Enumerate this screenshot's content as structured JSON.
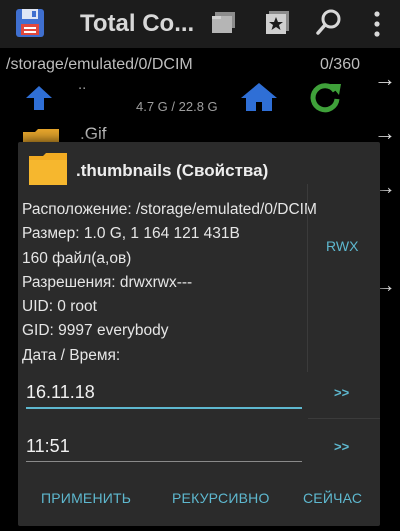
{
  "appbar": {
    "title": "Total Co...",
    "icons": [
      "floppy-save-icon",
      "folders-icon",
      "bookmark-star-icon",
      "search-icon",
      "overflow-menu-icon"
    ],
    "accent": "#5eb8cf"
  },
  "pathbar": {
    "path": "/storage/emulated/0/DCIM",
    "count": "0/360",
    "parent": "..",
    "storage": "4.7 G / 22.8 G"
  },
  "files": [
    {
      "name": ".Gif"
    }
  ],
  "dialog": {
    "title": ".thumbnails (Свойства)",
    "info": [
      "Расположение: /storage/emulated/0/DCIM",
      "Размер: 1.0 G, 1 164 121 431B",
      "160 файл(а,ов)",
      "Разрешения: drwxrwx---",
      "UID: 0 root",
      "GID: 9997 everybody",
      "Дата / Время:"
    ],
    "rwx": "RWX",
    "date_value": "16.11.18",
    "time_value": "11:51",
    "go_label": ">>",
    "buttons": {
      "apply": "ПРИМЕНИТЬ",
      "recursive": "РЕКУРСИВНО",
      "now": "СЕЙЧАС"
    }
  }
}
